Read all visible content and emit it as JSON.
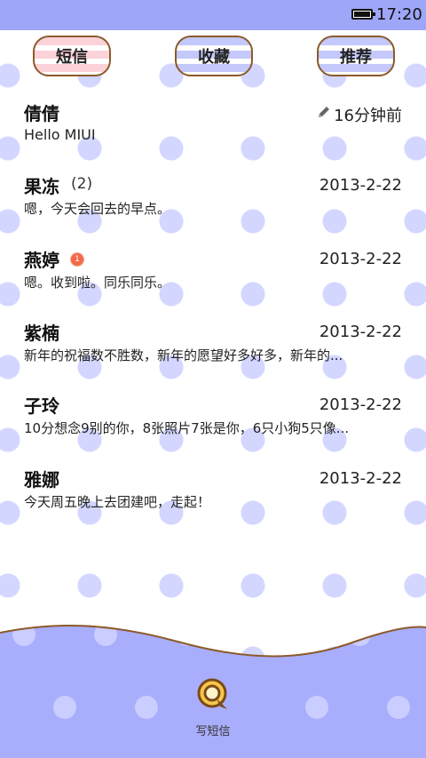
{
  "status_bar": {
    "time": "17:20"
  },
  "tabs": [
    {
      "label": "短信"
    },
    {
      "label": "收藏"
    },
    {
      "label": "推荐"
    }
  ],
  "threads": [
    {
      "sender": "倩倩",
      "time": "16分钟前",
      "preview": "Hello MIUI",
      "draft": true
    },
    {
      "sender": "果冻",
      "count": "(2)",
      "time": "2013-2-22",
      "preview": "嗯，今天会回去的早点。"
    },
    {
      "sender": "燕婷",
      "badge": "1",
      "time": "2013-2-22",
      "preview": "嗯。收到啦。同乐同乐。"
    },
    {
      "sender": "紫楠",
      "time": "2013-2-22",
      "preview": "新年的祝福数不胜数，新年的愿望好多好多，新年的..."
    },
    {
      "sender": "子玲",
      "time": "2013-2-22",
      "preview": "10分想念9别的你，8张照片7张是你，6只小狗5只像..."
    },
    {
      "sender": "雅娜",
      "time": "2013-2-22",
      "preview": "今天周五晚上去团建吧，走起！"
    }
  ],
  "compose": {
    "label": "写短信",
    "icon": "chat-bubble-icon"
  },
  "colors": {
    "accent": "#9ea6f8",
    "dot": "#d3d6ff",
    "border": "#8c5a2a",
    "badge": "#f26a4a"
  }
}
